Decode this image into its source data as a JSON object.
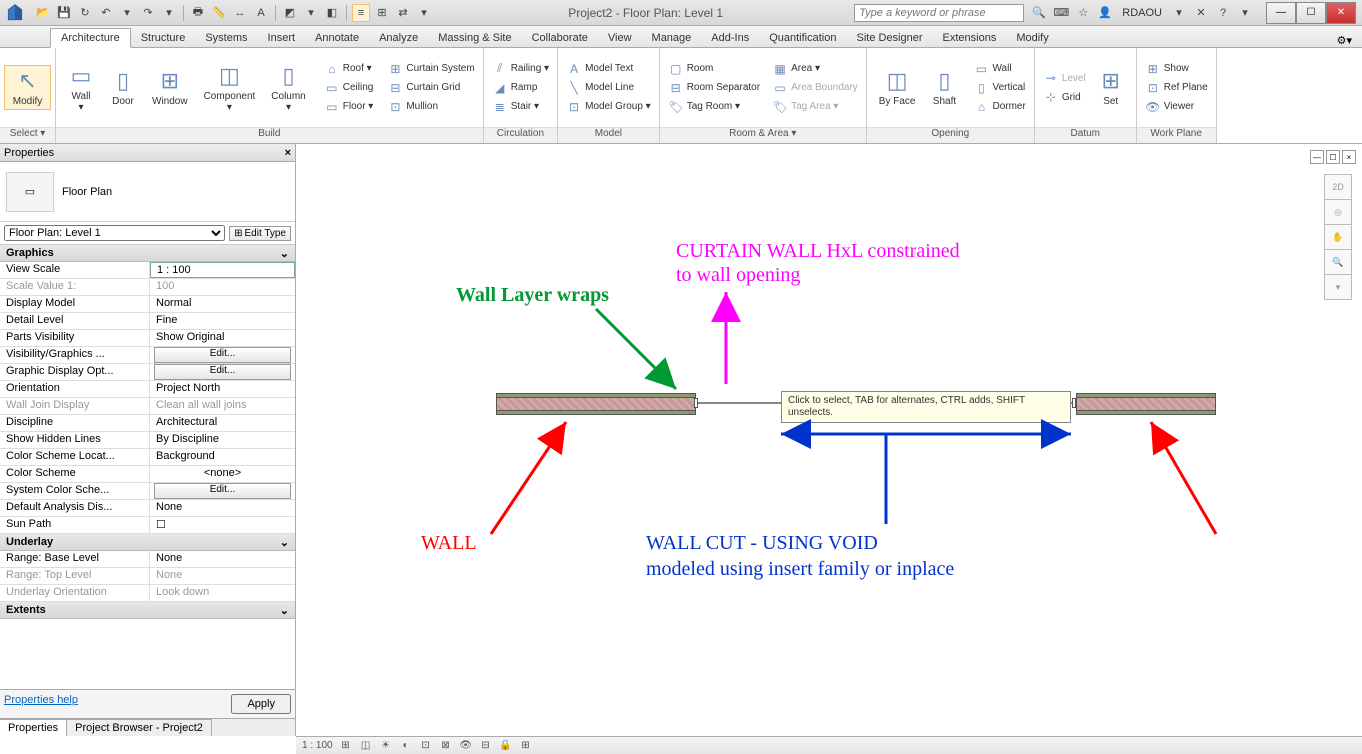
{
  "title": "Project2 - Floor Plan: Level 1",
  "search_placeholder": "Type a keyword or phrase",
  "user": "RDAOU",
  "tabs": [
    "Architecture",
    "Structure",
    "Systems",
    "Insert",
    "Annotate",
    "Analyze",
    "Massing & Site",
    "Collaborate",
    "View",
    "Manage",
    "Add-Ins",
    "Quantification",
    "Site Designer",
    "Extensions",
    "Modify"
  ],
  "active_tab": "Architecture",
  "ribbon": {
    "select_label": "Select ▾",
    "modify": "Modify",
    "build": {
      "label": "Build",
      "wall": "Wall",
      "door": "Door",
      "window": "Window",
      "component": "Component",
      "column": "Column",
      "roof": "Roof ▾",
      "ceiling": "Ceiling",
      "floor": "Floor ▾",
      "curtain_system": "Curtain System",
      "curtain_grid": "Curtain Grid",
      "mullion": "Mullion"
    },
    "circulation": {
      "label": "Circulation",
      "railing": "Railing ▾",
      "ramp": "Ramp",
      "stair": "Stair ▾"
    },
    "model": {
      "label": "Model",
      "text": "Model Text",
      "line": "Model Line",
      "group": "Model Group ▾"
    },
    "room_area": {
      "label": "Room & Area ▾",
      "room": "Room",
      "separator": "Room Separator",
      "tag_room": "Tag Room ▾",
      "area": "Area ▾",
      "area_boundary": "Area Boundary",
      "tag_area": "Tag Area ▾"
    },
    "opening": {
      "label": "Opening",
      "face": "By Face",
      "shaft": "Shaft",
      "wall": "Wall",
      "vertical": "Vertical",
      "dormer": "Dormer"
    },
    "datum": {
      "label": "Datum",
      "level": "Level",
      "grid": "Grid",
      "set": "Set"
    },
    "workplane": {
      "label": "Work Plane",
      "show": "Show",
      "ref": "Ref Plane",
      "viewer": "Viewer"
    }
  },
  "properties": {
    "title": "Properties",
    "type_name": "Floor Plan",
    "instance": "Floor Plan: Level 1",
    "edit_type": "Edit Type",
    "categories": [
      {
        "name": "Graphics",
        "rows": [
          {
            "k": "View Scale",
            "v": "1 : 100",
            "editable": true
          },
          {
            "k": "Scale Value   1:",
            "v": "100",
            "dim": true
          },
          {
            "k": "Display Model",
            "v": "Normal"
          },
          {
            "k": "Detail Level",
            "v": "Fine"
          },
          {
            "k": "Parts Visibility",
            "v": "Show Original"
          },
          {
            "k": "Visibility/Graphics ...",
            "btn": "Edit..."
          },
          {
            "k": "Graphic Display Opt...",
            "btn": "Edit..."
          },
          {
            "k": "Orientation",
            "v": "Project North"
          },
          {
            "k": "Wall Join Display",
            "v": "Clean all wall joins",
            "dim": true
          },
          {
            "k": "Discipline",
            "v": "Architectural"
          },
          {
            "k": "Show Hidden Lines",
            "v": "By Discipline"
          },
          {
            "k": "Color Scheme Locat...",
            "v": "Background"
          },
          {
            "k": "Color Scheme",
            "v": "<none>",
            "center": true
          },
          {
            "k": "System Color Sche...",
            "btn": "Edit..."
          },
          {
            "k": "Default Analysis Dis...",
            "v": "None"
          },
          {
            "k": "Sun Path",
            "v": "☐"
          }
        ]
      },
      {
        "name": "Underlay",
        "rows": [
          {
            "k": "Range: Base Level",
            "v": "None"
          },
          {
            "k": "Range: Top Level",
            "v": "None",
            "dim": true
          },
          {
            "k": "Underlay Orientation",
            "v": "Look down",
            "dim": true
          }
        ]
      },
      {
        "name": "Extents",
        "rows": []
      }
    ],
    "help": "Properties help",
    "apply": "Apply",
    "tabs": [
      "Properties",
      "Project Browser - Project2"
    ]
  },
  "canvas": {
    "tooltip": "Click to select, TAB for alternates, CTRL adds, SHIFT unselects.",
    "ann_wall": "WALL",
    "ann_layer": "Wall Layer wraps",
    "ann_curtain1": "CURTAIN WALL HxL constrained",
    "ann_curtain2": "to wall opening",
    "ann_void1": "WALL CUT - USING VOID",
    "ann_void2": "modeled using insert family or inplace"
  },
  "status": {
    "scale": "1 : 100"
  }
}
